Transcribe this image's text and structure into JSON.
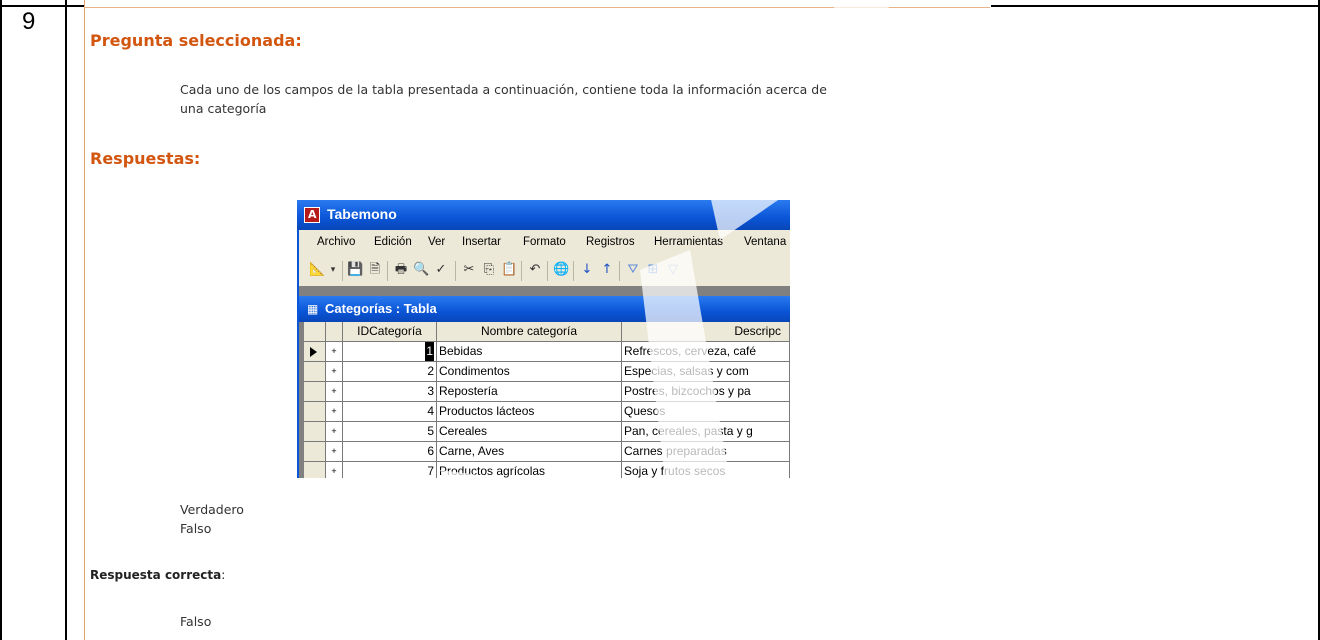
{
  "document": {
    "question_number": "9"
  },
  "quiz": {
    "selected_question_heading": "Pregunta seleccionada:",
    "question_text_line1": "Cada uno de los campos de la tabla presentada a continuación, contiene toda la información acerca de",
    "question_text_line2": "una categoría",
    "answers_heading": "Respuestas:",
    "options": [
      "Verdadero",
      "Falso"
    ],
    "correct_answer_label": "Respuesta correcta",
    "correct_answer_colon": ":",
    "correct_answer_value": "Falso"
  },
  "access_window": {
    "title": "Tabemono",
    "menu": [
      "Archivo",
      "Edición",
      "Ver",
      "Insertar",
      "Formato",
      "Registros",
      "Herramientas",
      "Ventana"
    ],
    "toolbar_icons": [
      "view-design-icon",
      "dropdown-arrow-icon",
      "save-icon",
      "file-search-icon",
      "print-icon",
      "print-preview-icon",
      "spelling-icon",
      "cut-icon",
      "copy-icon",
      "paste-icon",
      "undo-icon",
      "hyperlink-icon",
      "sort-ascending-icon",
      "sort-descending-icon",
      "filter-by-selection-icon",
      "filter-by-form-icon",
      "apply-filter-icon"
    ],
    "table_window": {
      "title": "Categorías : Tabla",
      "columns": [
        "IDCategoría",
        "Nombre categoría",
        "Descripc"
      ],
      "rows": [
        {
          "id": "1",
          "name": "Bebidas",
          "desc": "Refrescos, cerveza, café"
        },
        {
          "id": "2",
          "name": "Condimentos",
          "desc": "Especias, salsas y com"
        },
        {
          "id": "3",
          "name": "Repostería",
          "desc": "Postres, bizcochos y pa"
        },
        {
          "id": "4",
          "name": "Productos lácteos",
          "desc": "Quesos"
        },
        {
          "id": "5",
          "name": "Cereales",
          "desc": "Pan, cereales, pasta y g"
        },
        {
          "id": "6",
          "name": "Carne, Aves",
          "desc": "Carnes preparadas"
        },
        {
          "id": "7",
          "name": "Productos agrícolas",
          "desc": "Soja y frutos secos"
        }
      ],
      "expand_symbol": "+"
    }
  },
  "colors": {
    "heading_orange": "#d2560f",
    "xp_blue": "#0a55d6",
    "xp_face": "#ece9d8"
  }
}
